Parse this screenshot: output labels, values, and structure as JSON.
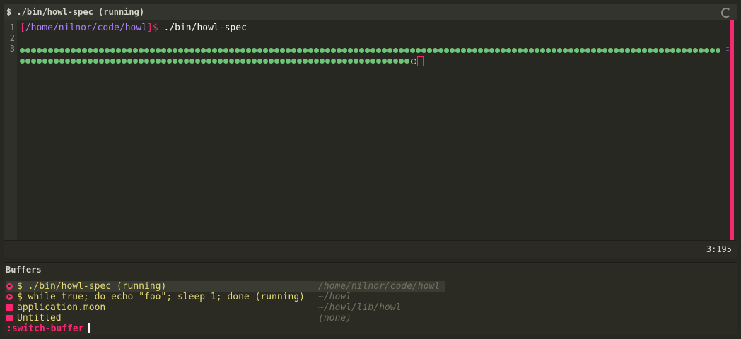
{
  "window": {
    "title": "$ ./bin/howl-spec (running)",
    "spinner_icon": "spinner-icon"
  },
  "editor": {
    "line_numbers": [
      "1",
      "2",
      "3"
    ],
    "prompt": {
      "open": "[",
      "path": "/home/nilnor/code/howl",
      "close": "]",
      "dollar": "$",
      "command": " ./bin/howl-spec"
    },
    "progress": {
      "row1_passed": 124,
      "row2_passed": 69,
      "pending": 1
    },
    "wrap_indicator": "⌯"
  },
  "status": {
    "cursor_position": "3:195"
  },
  "buffers": {
    "title": "Buffers",
    "items": [
      {
        "name": "$ ./bin/howl-spec (running)",
        "dir": "/home/nilnor/code/howl",
        "icon": "process",
        "selected": true
      },
      {
        "name": "$ while true; do echo \"foo\"; sleep 1; done (running)",
        "dir": "~/howl",
        "icon": "process",
        "selected": false
      },
      {
        "name": "application.moon",
        "dir": "~/howl/lib/howl",
        "icon": "file",
        "selected": false
      },
      {
        "name": "Untitled",
        "dir": "(none)",
        "icon": "file",
        "selected": false
      }
    ]
  },
  "command_line": {
    "label": ":switch-buffer",
    "value": ""
  },
  "colors": {
    "accent": "#f92672",
    "pass": "#6ec377",
    "prompt_path": "#ae81ff",
    "buffer_name": "#e6db74",
    "buffer_dir": "#75715e"
  }
}
